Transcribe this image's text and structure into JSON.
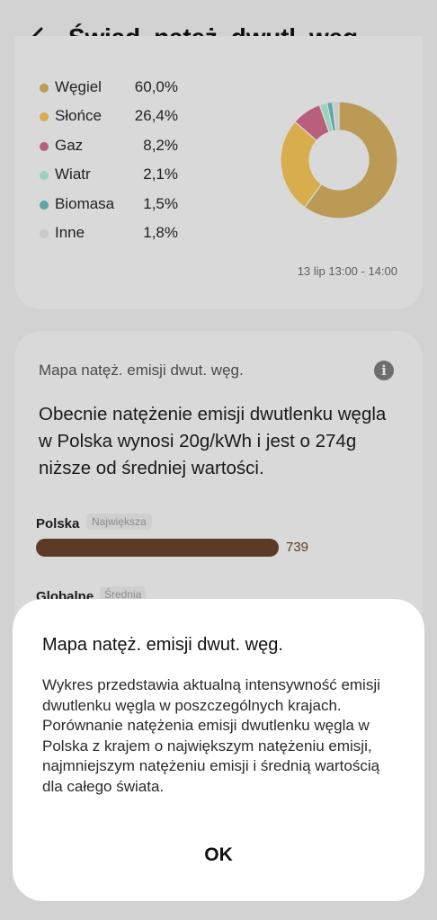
{
  "header": {
    "title": "Świad. natęż. dwutl. węg."
  },
  "legend": [
    {
      "name": "Węgiel",
      "value": "60,0%",
      "color": "#bb9a55"
    },
    {
      "name": "Słońce",
      "value": "26,4%",
      "color": "#d7ad4e"
    },
    {
      "name": "Gaz",
      "value": "8,2%",
      "color": "#b95f7e"
    },
    {
      "name": "Wiatr",
      "value": "2,1%",
      "color": "#9bd1bf"
    },
    {
      "name": "Biomasa",
      "value": "1,5%",
      "color": "#5ba7a3"
    },
    {
      "name": "Inne",
      "value": "1,8%",
      "color": "#c9c9c9"
    }
  ],
  "chart_data": {
    "type": "pie",
    "categories": [
      "Węgiel",
      "Słońce",
      "Gaz",
      "Wiatr",
      "Biomasa",
      "Inne"
    ],
    "values": [
      60.0,
      26.4,
      8.2,
      2.1,
      1.5,
      1.8
    ],
    "colors": [
      "#bb9a55",
      "#d7ad4e",
      "#b95f7e",
      "#9bd1bf",
      "#5ba7a3",
      "#c9c9c9"
    ],
    "donut": true
  },
  "chart_time": "13 lip 13:00 - 14:00",
  "map": {
    "title": "Mapa natęż. emisji dwut. węg.",
    "description": "Obecnie natężenie emisji dwutlenku węgla w Polska wynosi 20g/kWh i jest o 274g niższe od średniej wartości.",
    "country": {
      "name": "Polska",
      "badge": "Największa",
      "value": "739",
      "bar_fraction": 1.0
    },
    "global": {
      "name": "Globalne",
      "badge": "Średnia"
    }
  },
  "dialog": {
    "title": "Mapa natęż. emisji dwut. węg.",
    "body": "Wykres przedstawia aktualną intensywność emisji dwutlenku węgla w poszczególnych krajach. Porównanie natężenia emisji dwutlenku węgla w Polska z krajem o największym natężeniu emisji, najmniejszym natężeniu emisji i średnią wartością dla całego świata.",
    "ok_label": "OK"
  }
}
